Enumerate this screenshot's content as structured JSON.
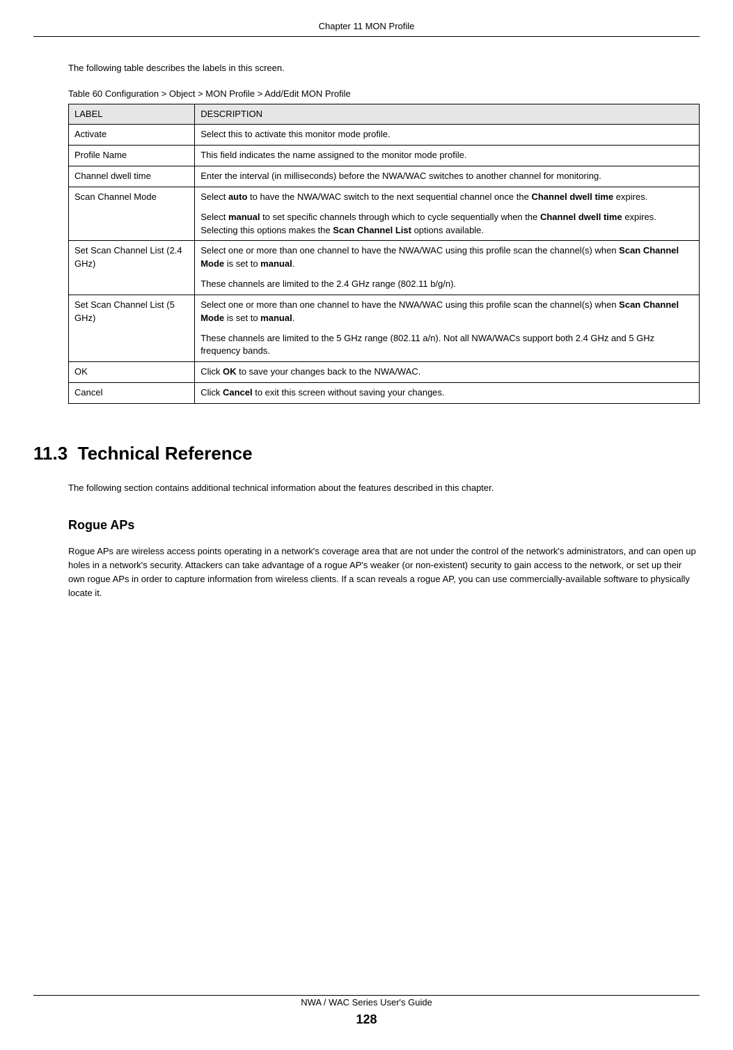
{
  "header": {
    "chapter": "Chapter 11 MON Profile"
  },
  "intro": "The following table describes the labels in this screen.",
  "table_caption": "Table 60   Configuration > Object > MON Profile > Add/Edit MON Profile",
  "table": {
    "headers": {
      "label": "LABEL",
      "description": "DESCRIPTION"
    },
    "rows": [
      {
        "label": "Activate",
        "desc": [
          {
            "text": "Select this to activate this monitor mode profile."
          }
        ]
      },
      {
        "label": "Profile Name",
        "desc": [
          {
            "text": "This field indicates the name assigned to the monitor mode profile."
          }
        ]
      },
      {
        "label": "Channel dwell time",
        "desc": [
          {
            "text": "Enter the interval (in milliseconds) before the NWA/WAC switches to another channel for monitoring."
          }
        ]
      },
      {
        "label": "Scan Channel Mode",
        "desc": [
          {
            "html": "Select <b>auto</b> to have the NWA/WAC switch to the next sequential channel once the <b>Channel dwell time</b> expires."
          },
          {
            "html": "Select <b>manual</b> to set specific channels through which to cycle sequentially when the <b>Channel dwell time</b> expires. Selecting this options makes the <b>Scan Channel List</b> options available."
          }
        ]
      },
      {
        "label": "Set Scan Channel List (2.4 GHz)",
        "desc": [
          {
            "html": "Select one or more than one channel to have the NWA/WAC using this profile scan the channel(s) when <b>Scan Channel Mode</b> is set to <b>manual</b>."
          },
          {
            "text": "These channels are limited to the 2.4 GHz range (802.11 b/g/n)."
          }
        ]
      },
      {
        "label": "Set Scan Channel List (5 GHz)",
        "desc": [
          {
            "html": "Select one or more than one channel to have the NWA/WAC using this profile scan the channel(s) when <b>Scan Channel Mode</b> is set to <b>manual</b>."
          },
          {
            "text": "These channels are limited to the 5 GHz range (802.11 a/n). Not all NWA/WACs support both 2.4 GHz and 5 GHz frequency bands."
          }
        ]
      },
      {
        "label": "OK",
        "desc": [
          {
            "html": "Click <b>OK</b> to save your changes back to the NWA/WAC."
          }
        ]
      },
      {
        "label": "Cancel",
        "desc": [
          {
            "html": "Click <b>Cancel</b> to exit this screen without saving your changes."
          }
        ]
      }
    ]
  },
  "section": {
    "number": "11.3",
    "title": "Technical Reference",
    "intro": "The following section contains additional technical information about the features described in this chapter.",
    "subsection": {
      "title": "Rogue APs",
      "text": "Rogue APs are wireless access points operating in a network's coverage area that are not under the control of the network's administrators, and can open up holes in a network's security. Attackers can take advantage of a rogue AP's weaker (or non-existent) security to gain access to the network, or set up their own rogue APs in order to capture information from wireless clients. If a scan reveals a rogue AP, you can use commercially-available software to physically locate it."
    }
  },
  "footer": {
    "guide": "NWA / WAC Series User's Guide",
    "page": "128"
  }
}
